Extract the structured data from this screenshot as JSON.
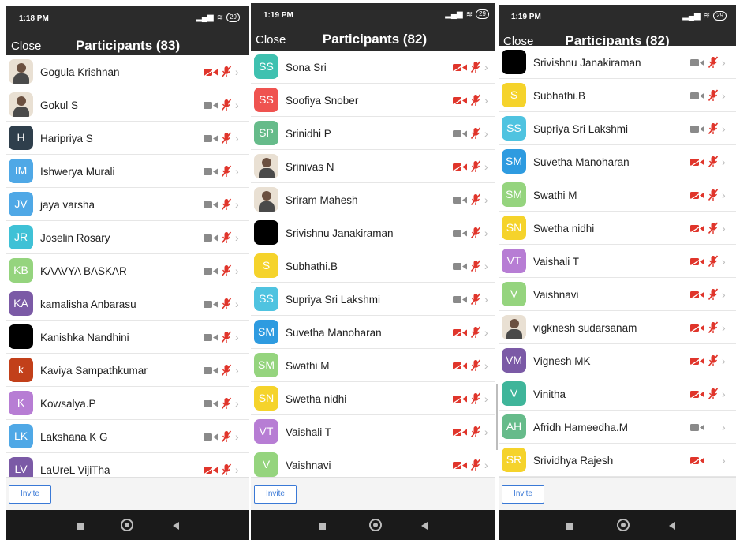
{
  "colors": {
    "header_bg": "#2b2b2b",
    "muted_red": "#e0352b",
    "icon_gray": "#8a8a8a",
    "invite_blue": "#3a79d6"
  },
  "icons": {
    "camera_off": "video-camera-off-icon",
    "camera_on": "video-camera-icon",
    "mic_off": "microphone-muted-icon",
    "chevron": "chevron-right-icon"
  },
  "panels": [
    {
      "status_time": "1:18 PM",
      "battery": "29",
      "close_label": "Close",
      "title": "Participants (83)",
      "invite_label": "Invite",
      "participants": [
        {
          "name": "Gogula Krishnan",
          "initials": "",
          "color": "",
          "photo": true,
          "cam": "red",
          "mic": "red",
          "chevron": true
        },
        {
          "name": "Gokul S",
          "initials": "",
          "color": "",
          "photo": true,
          "cam": "gray",
          "mic": "red",
          "chevron": true
        },
        {
          "name": "Haripriya S",
          "initials": "H",
          "color": "#2f3f4c",
          "photo": false,
          "cam": "gray",
          "mic": "red",
          "chevron": true
        },
        {
          "name": "Ishwerya Murali",
          "initials": "IM",
          "color": "#4fa8e6",
          "photo": false,
          "cam": "gray",
          "mic": "red",
          "chevron": true
        },
        {
          "name": "jaya varsha",
          "initials": "JV",
          "color": "#4fa8e6",
          "photo": false,
          "cam": "gray",
          "mic": "red",
          "chevron": true
        },
        {
          "name": "Joselin Rosary",
          "initials": "JR",
          "color": "#3fc1d6",
          "photo": false,
          "cam": "gray",
          "mic": "red",
          "chevron": true
        },
        {
          "name": "KAAVYA BASKAR",
          "initials": "KB",
          "color": "#95d47e",
          "photo": false,
          "cam": "gray",
          "mic": "red",
          "chevron": true
        },
        {
          "name": "kamalisha Anbarasu",
          "initials": "KA",
          "color": "#7b5aa6",
          "photo": false,
          "cam": "gray",
          "mic": "red",
          "chevron": true
        },
        {
          "name": "Kanishka Nandhini",
          "initials": "",
          "color": "#000000",
          "photo": false,
          "cam": "gray",
          "mic": "red",
          "chevron": true
        },
        {
          "name": "Kaviya Sampathkumar",
          "initials": "k",
          "color": "#c2401a",
          "photo": false,
          "cam": "gray",
          "mic": "red",
          "chevron": true
        },
        {
          "name": "Kowsalya.P",
          "initials": "K",
          "color": "#b77dd4",
          "photo": false,
          "cam": "gray",
          "mic": "red",
          "chevron": true
        },
        {
          "name": "Lakshana K G",
          "initials": "LK",
          "color": "#4fa8e6",
          "photo": false,
          "cam": "gray",
          "mic": "red",
          "chevron": true
        },
        {
          "name": "LaUreL VijiTha",
          "initials": "LV",
          "color": "#7b5aa6",
          "photo": false,
          "cam": "red",
          "mic": "red",
          "chevron": true
        }
      ]
    },
    {
      "status_time": "1:19 PM",
      "battery": "29",
      "close_label": "Close",
      "title": "Participants (82)",
      "invite_label": "Invite",
      "participants": [
        {
          "name": "Sona Sri",
          "initials": "SS",
          "color": "#3fc1b0",
          "photo": false,
          "cam": "red",
          "mic": "red",
          "chevron": true
        },
        {
          "name": "Soofiya Snober",
          "initials": "SS",
          "color": "#ef5350",
          "photo": false,
          "cam": "red",
          "mic": "red",
          "chevron": true
        },
        {
          "name": "Srinidhi P",
          "initials": "SP",
          "color": "#66bb8a",
          "photo": false,
          "cam": "gray",
          "mic": "red",
          "chevron": true
        },
        {
          "name": "Srinivas N",
          "initials": "",
          "color": "",
          "photo": true,
          "cam": "red",
          "mic": "red",
          "chevron": true
        },
        {
          "name": "Sriram Mahesh",
          "initials": "",
          "color": "",
          "photo": true,
          "cam": "gray",
          "mic": "red",
          "chevron": true
        },
        {
          "name": "Srivishnu Janakiraman",
          "initials": "",
          "color": "#000000",
          "photo": false,
          "cam": "gray",
          "mic": "red",
          "chevron": true
        },
        {
          "name": "Subhathi.B",
          "initials": "S",
          "color": "#f5d32b",
          "photo": false,
          "cam": "gray",
          "mic": "red",
          "chevron": true
        },
        {
          "name": "Supriya Sri Lakshmi",
          "initials": "SS",
          "color": "#4fc3e0",
          "photo": false,
          "cam": "gray",
          "mic": "red",
          "chevron": true
        },
        {
          "name": "Suvetha Manoharan",
          "initials": "SM",
          "color": "#2e9be0",
          "photo": false,
          "cam": "red",
          "mic": "red",
          "chevron": true
        },
        {
          "name": "Swathi M",
          "initials": "SM",
          "color": "#95d47e",
          "photo": false,
          "cam": "red",
          "mic": "red",
          "chevron": true
        },
        {
          "name": "Swetha nidhi",
          "initials": "SN",
          "color": "#f5d32b",
          "photo": false,
          "cam": "red",
          "mic": "red",
          "chevron": true
        },
        {
          "name": "Vaishali T",
          "initials": "VT",
          "color": "#b77dd4",
          "photo": false,
          "cam": "red",
          "mic": "red",
          "chevron": true
        },
        {
          "name": "Vaishnavi",
          "initials": "V",
          "color": "#95d47e",
          "photo": false,
          "cam": "red",
          "mic": "red",
          "chevron": true
        }
      ]
    },
    {
      "status_time": "1:19 PM",
      "battery": "29",
      "close_label": "Close",
      "title": "Participants (82)",
      "invite_label": "Invite",
      "participants": [
        {
          "name": "Srivishnu Janakiraman",
          "initials": "",
          "color": "#000000",
          "photo": false,
          "cam": "gray",
          "mic": "red",
          "chevron": true
        },
        {
          "name": "Subhathi.B",
          "initials": "S",
          "color": "#f5d32b",
          "photo": false,
          "cam": "gray",
          "mic": "red",
          "chevron": true
        },
        {
          "name": "Supriya Sri Lakshmi",
          "initials": "SS",
          "color": "#4fc3e0",
          "photo": false,
          "cam": "gray",
          "mic": "red",
          "chevron": true
        },
        {
          "name": "Suvetha Manoharan",
          "initials": "SM",
          "color": "#2e9be0",
          "photo": false,
          "cam": "red",
          "mic": "red",
          "chevron": true
        },
        {
          "name": "Swathi M",
          "initials": "SM",
          "color": "#95d47e",
          "photo": false,
          "cam": "red",
          "mic": "red",
          "chevron": true
        },
        {
          "name": "Swetha nidhi",
          "initials": "SN",
          "color": "#f5d32b",
          "photo": false,
          "cam": "red",
          "mic": "red",
          "chevron": true
        },
        {
          "name": "Vaishali T",
          "initials": "VT",
          "color": "#b77dd4",
          "photo": false,
          "cam": "red",
          "mic": "red",
          "chevron": true
        },
        {
          "name": "Vaishnavi",
          "initials": "V",
          "color": "#95d47e",
          "photo": false,
          "cam": "red",
          "mic": "red",
          "chevron": true
        },
        {
          "name": "vigknesh sudarsanam",
          "initials": "",
          "color": "",
          "photo": true,
          "cam": "red",
          "mic": "red",
          "chevron": true
        },
        {
          "name": "Vignesh MK",
          "initials": "VM",
          "color": "#7b5aa6",
          "photo": false,
          "cam": "red",
          "mic": "red",
          "chevron": true
        },
        {
          "name": "Vinitha",
          "initials": "V",
          "color": "#3fb59a",
          "photo": false,
          "cam": "red",
          "mic": "red",
          "chevron": true
        },
        {
          "name": "Afridh Hameedha.M",
          "initials": "AH",
          "color": "#66bb8a",
          "photo": false,
          "cam": "gray",
          "mic": "none",
          "chevron": true
        },
        {
          "name": "Srividhya Rajesh",
          "initials": "SR",
          "color": "#f5d32b",
          "photo": false,
          "cam": "red",
          "mic": "none",
          "chevron": true
        }
      ]
    }
  ]
}
